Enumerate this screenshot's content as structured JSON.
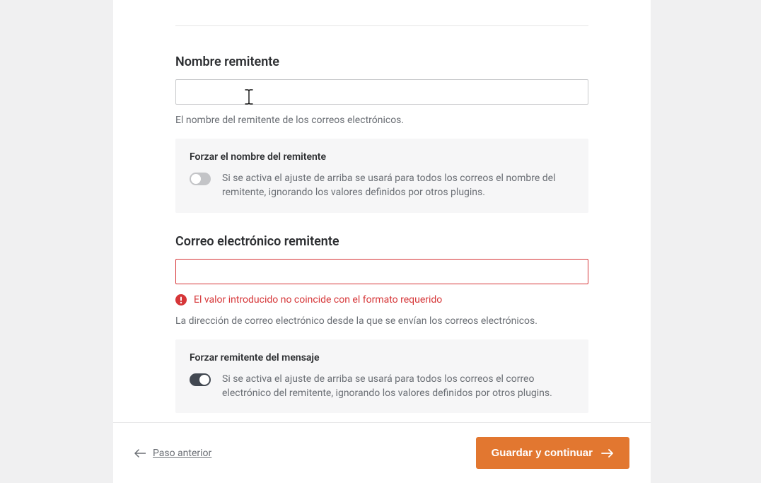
{
  "senderName": {
    "label": "Nombre remitente",
    "value": "",
    "help": "El nombre del remitente de los correos electrónicos.",
    "force": {
      "title": "Forzar el nombre del remitente",
      "desc": "Si se activa el ajuste de arriba se usará para todos los correos el nombre del remitente, ignorando los valores definidos por otros plugins.",
      "enabled": false
    }
  },
  "senderEmail": {
    "label": "Correo electrónico remitente",
    "value": "",
    "error": "El valor introducido no coincide con el formato requerido",
    "help": "La dirección de correo electrónico desde la que se envían los correos electrónicos.",
    "force": {
      "title": "Forzar remitente del mensaje",
      "desc": "Si se activa el ajuste de arriba se usará para todos los correos el correo electrónico del remitente, ignorando los valores definidos por otros plugins.",
      "enabled": true
    }
  },
  "footer": {
    "backLabel": "Paso anterior",
    "saveLabel": "Guardar y continuar"
  }
}
